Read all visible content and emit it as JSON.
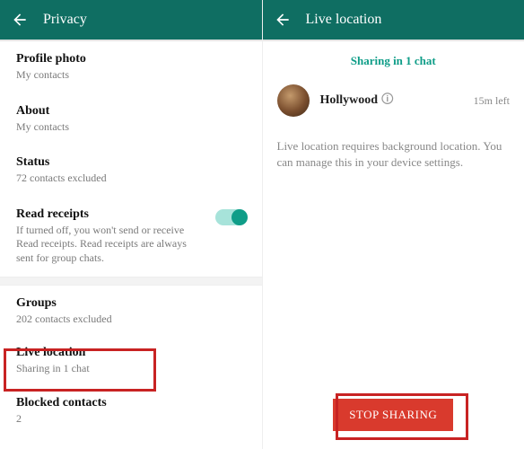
{
  "left": {
    "header": {
      "title": "Privacy"
    },
    "profile_photo": {
      "title": "Profile photo",
      "sub": "My contacts"
    },
    "about": {
      "title": "About",
      "sub": "My contacts"
    },
    "status": {
      "title": "Status",
      "sub": "72 contacts excluded"
    },
    "read_receipts": {
      "title": "Read receipts",
      "sub": "If turned off, you won't send or receive Read receipts. Read receipts are always sent for group chats.",
      "enabled": true
    },
    "groups": {
      "title": "Groups",
      "sub": "202 contacts excluded"
    },
    "live_location": {
      "title": "Live location",
      "sub": "Sharing in 1 chat"
    },
    "blocked": {
      "title": "Blocked contacts",
      "sub": "2"
    }
  },
  "right": {
    "header": {
      "title": "Live location"
    },
    "status_text": "Sharing in 1 chat",
    "chat": {
      "name": "Hollywood",
      "suffix": "🛈",
      "time_left": "15m left"
    },
    "info": "Live location requires background location. You can manage this in your device settings.",
    "stop_button": "STOP SHARING"
  }
}
